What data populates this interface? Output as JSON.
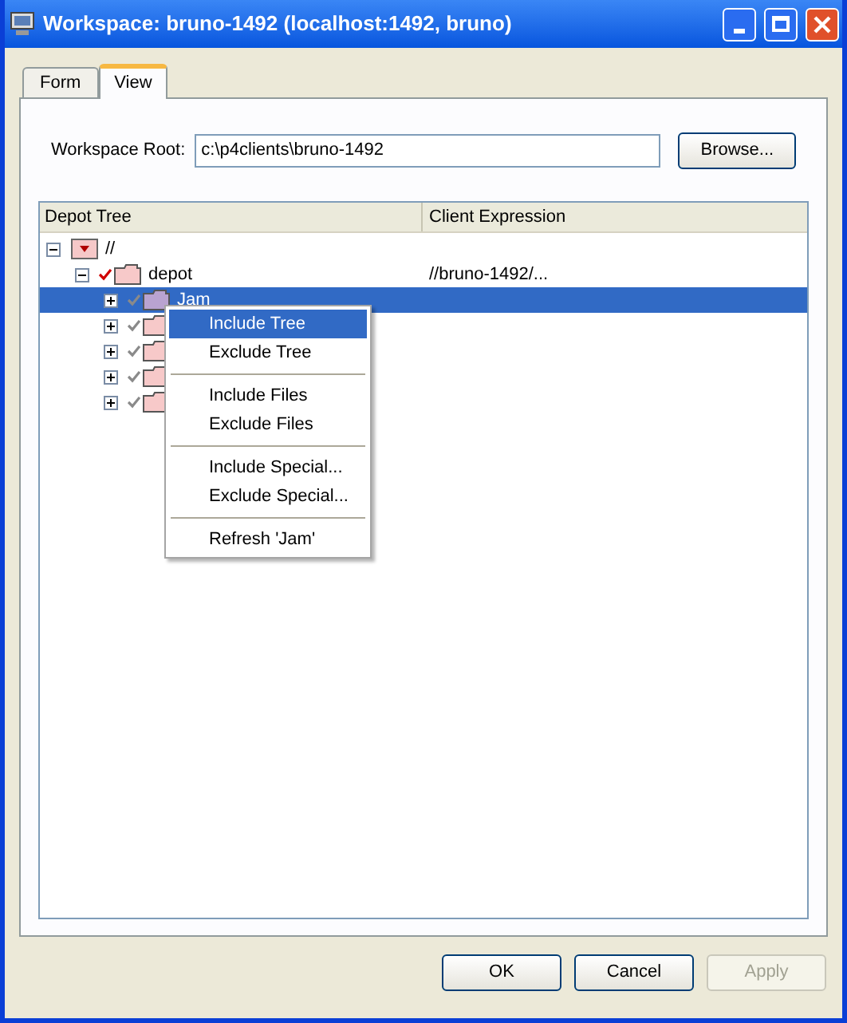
{
  "window": {
    "title": "Workspace: bruno-1492 (localhost:1492, bruno)"
  },
  "tabs": [
    {
      "label": "Form",
      "selected": false
    },
    {
      "label": "View",
      "selected": true
    }
  ],
  "workspace_root": {
    "label": "Workspace Root:",
    "value": "c:\\p4clients\\bruno-1492",
    "button": "Browse..."
  },
  "tree": {
    "columns": [
      "Depot Tree",
      "Client Expression"
    ],
    "items": [
      {
        "label": "//",
        "expanded": true,
        "kind": "root",
        "children": [
          {
            "label": "depot",
            "expanded": true,
            "kind": "folder",
            "explicit": true,
            "expression": "//bruno-1492/...",
            "selected": false,
            "children": [
              {
                "label": "Jam",
                "expanded": false,
                "kind": "folder",
                "explicit": false,
                "selected": true
              },
              {
                "expanded": false,
                "kind": "folder",
                "explicit": false,
                "selected": false
              },
              {
                "expanded": false,
                "kind": "folder",
                "explicit": false,
                "selected": false
              },
              {
                "expanded": false,
                "kind": "folder",
                "explicit": false,
                "selected": false
              },
              {
                "expanded": false,
                "kind": "folder",
                "explicit": false,
                "selected": false
              }
            ]
          }
        ]
      }
    ]
  },
  "context_menu": [
    {
      "kind": "item",
      "label": "Include Tree",
      "selected": true
    },
    {
      "kind": "item",
      "label": "Exclude Tree",
      "selected": false
    },
    {
      "kind": "separator"
    },
    {
      "kind": "item",
      "label": "Include Files",
      "selected": false
    },
    {
      "kind": "item",
      "label": "Exclude Files",
      "selected": false
    },
    {
      "kind": "separator"
    },
    {
      "kind": "item",
      "label": "Include Special...",
      "selected": false
    },
    {
      "kind": "item",
      "label": "Exclude Special...",
      "selected": false
    },
    {
      "kind": "separator"
    },
    {
      "kind": "item",
      "label": "Refresh 'Jam'",
      "selected": false
    }
  ],
  "buttons": [
    {
      "label": "OK",
      "disabled": false
    },
    {
      "label": "Cancel",
      "disabled": false
    },
    {
      "label": "Apply",
      "disabled": true
    }
  ]
}
